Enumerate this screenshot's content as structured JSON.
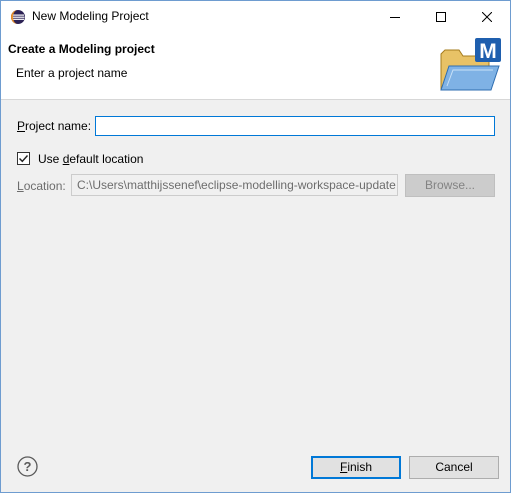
{
  "window": {
    "title": "New Modeling Project",
    "app_icon": "eclipse-icon",
    "controls": [
      "minimize-icon",
      "maximize-icon",
      "close-icon"
    ]
  },
  "header": {
    "title": "Create a Modeling project",
    "subtitle": "Enter a project name",
    "image_icon": "modeling-project-folder-icon",
    "image_letter": "M"
  },
  "form": {
    "project_name_label_mnemonic": "P",
    "project_name_label_rest": "roject name:",
    "project_name_value": "",
    "use_default_label_prefix": "Use ",
    "use_default_label_mnemonic": "d",
    "use_default_label_rest": "efault location",
    "use_default_checked": true,
    "location_label_mnemonic": "L",
    "location_label_rest": "ocation:",
    "location_value": "C:\\Users\\matthijssenef\\eclipse-modelling-workspace-update",
    "browse_label": "Browse..."
  },
  "footer": {
    "help_icon": "help-icon",
    "finish_mnemonic": "F",
    "finish_rest": "inish",
    "cancel_label": "Cancel"
  },
  "colors": {
    "focus_border": "#0078d7",
    "window_border": "#6e9cd0",
    "dialog_bg": "#f0f0f0"
  }
}
